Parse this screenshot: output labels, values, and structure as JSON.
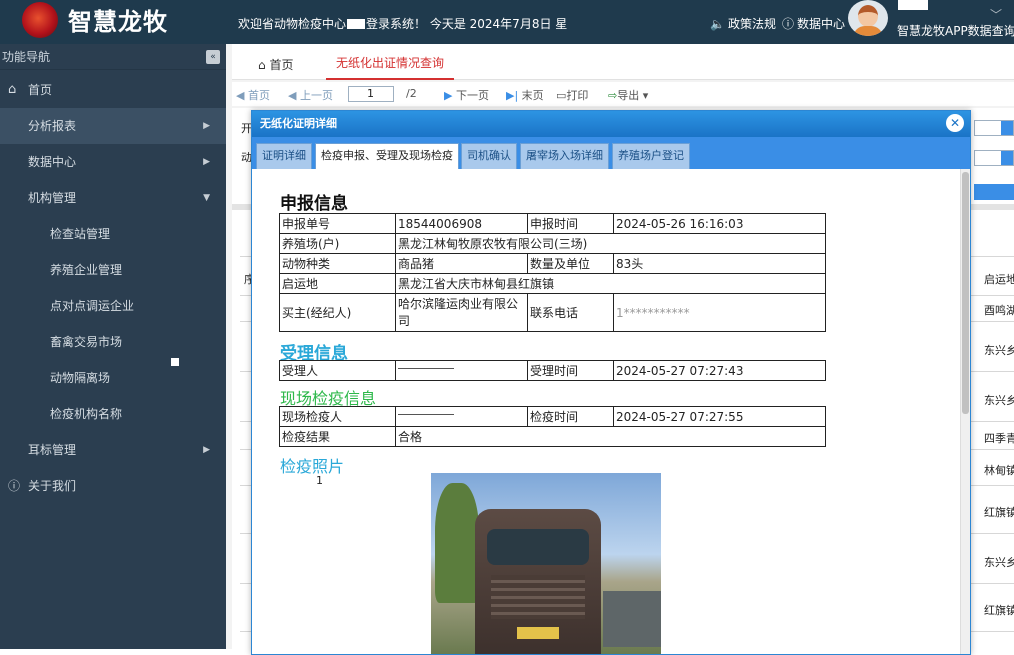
{
  "header": {
    "logo_text": "智慧龙牧",
    "welcome_pre": "欢迎省动物检疫中心",
    "welcome_post": "登录系统！ 今天是 2024年7月8日 星",
    "nav_policy": "政策法规",
    "nav_data": "数据中心",
    "app_link": "智慧龙牧APP数据查询"
  },
  "sidebar": {
    "title": "功能导航",
    "items": [
      {
        "label": "首页"
      },
      {
        "label": "分析报表"
      },
      {
        "label": "数据中心"
      },
      {
        "label": "机构管理"
      },
      {
        "label": "检查站管理"
      },
      {
        "label": "养殖企业管理"
      },
      {
        "label": "点对点调运企业"
      },
      {
        "label": "畜禽交易市场"
      },
      {
        "label": "动物隔离场"
      },
      {
        "label": "检疫机构名称"
      },
      {
        "label": "耳标管理"
      },
      {
        "label": "关于我们"
      }
    ]
  },
  "main": {
    "tabs": [
      {
        "label": "首页"
      },
      {
        "label": "无纸化出证情况查询"
      }
    ],
    "toolbar": {
      "first": "首页",
      "prev": "上一页",
      "page": "1",
      "total": "/2",
      "next": "下一页",
      "last": "末页",
      "print": "打印",
      "export": "导出"
    },
    "bg_list": {
      "col_prefix_1": "开",
      "col_prefix_2": "动",
      "col_prefix_3": "序",
      "header_origin": "启运地",
      "rows": [
        "酉鸣湖镇",
        "东兴乡新",
        "东兴乡新",
        "四季青镇",
        "林甸镇巨",
        "红旗镇先",
        "东兴乡新",
        "红旗镇先"
      ]
    }
  },
  "modal": {
    "title": "无纸化证明详细",
    "tabs": [
      "证明详细",
      "检疫申报、受理及现场检疫",
      "司机确认",
      "屠宰场入场详细",
      "养殖场户登记"
    ],
    "report_heading": "申报信息",
    "report": {
      "no_label": "申报单号",
      "no": "18544006908",
      "time_label": "申报时间",
      "time": "2024-05-26 16:16:03",
      "farm_label": "养殖场(户)",
      "farm": "黑龙江林甸牧原农牧有限公司(三场)",
      "species_label": "动物种类",
      "species": "商品猪",
      "qty_label": "数量及单位",
      "qty": "83头",
      "origin_label": "启运地",
      "origin": "黑龙江省大庆市林甸县红旗镇",
      "buyer_label": "买主(经纪人)",
      "buyer": "哈尔滨隆运肉业有限公司",
      "phone_label": "联系电话",
      "phone": "1***********"
    },
    "accept_heading": "受理信息",
    "accept": {
      "person_label": "受理人",
      "time_label": "受理时间",
      "time": "2024-05-27 07:27:43"
    },
    "field_heading": "现场检疫信息",
    "field": {
      "person_label": "现场检疫人",
      "time_label": "检疫时间",
      "time": "2024-05-27 07:27:55",
      "result_label": "检疫结果",
      "result": "合格"
    },
    "photo_heading": "检疫照片",
    "photo_index": "1"
  }
}
